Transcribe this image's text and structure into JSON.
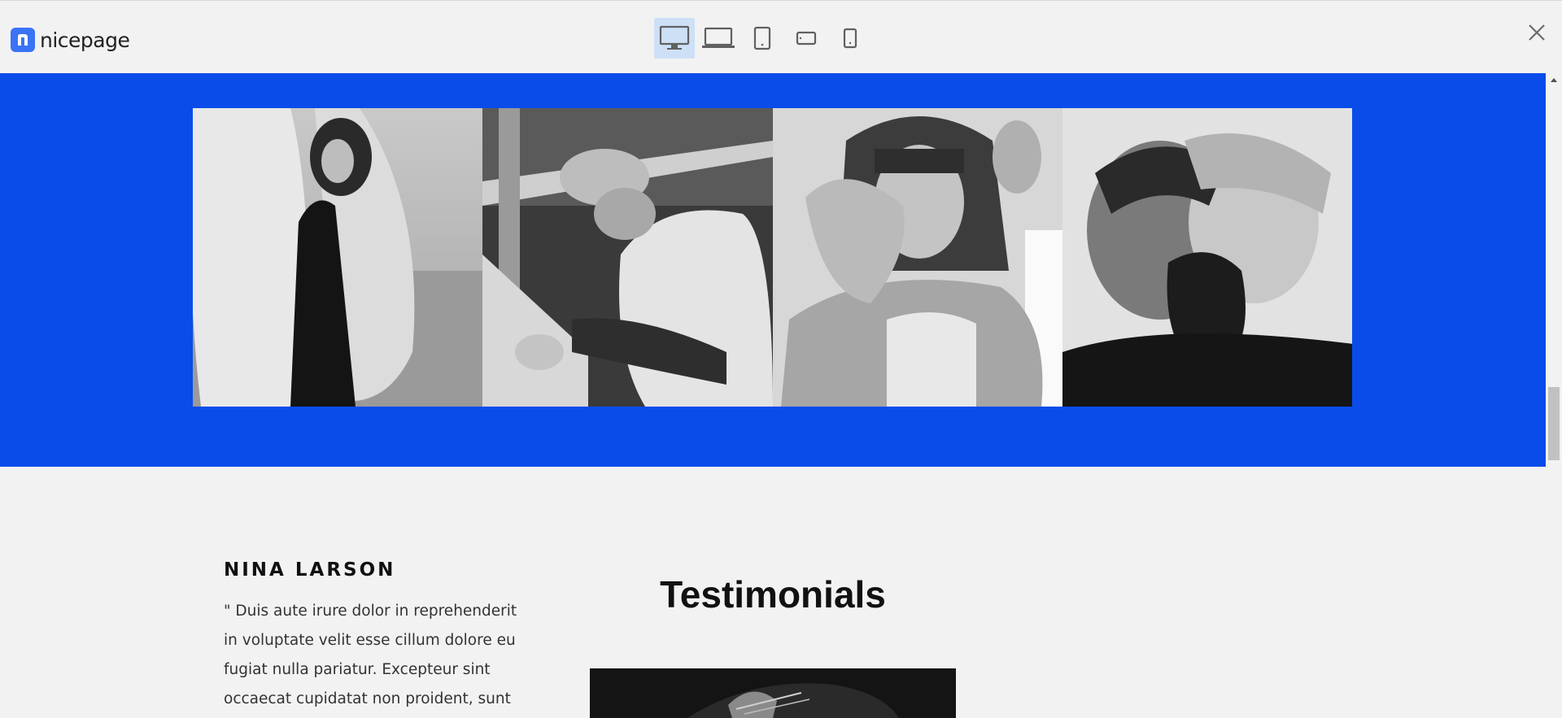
{
  "app": {
    "logo_text": "nicepage"
  },
  "toolbar": {
    "devices": [
      {
        "name": "desktop",
        "active": true
      },
      {
        "name": "laptop",
        "active": false
      },
      {
        "name": "tablet",
        "active": false
      },
      {
        "name": "phone-landscape",
        "active": false
      },
      {
        "name": "phone-portrait",
        "active": false
      }
    ],
    "active_color": "#cde0f6"
  },
  "gallery": {
    "background_color": "#0a4cea",
    "photos": [
      {
        "subject": "woman with curly hair wrapped in white fabric on a beach"
      },
      {
        "subject": "man in beanie and fleece jacket leaning on railing"
      },
      {
        "subject": "woman with bangs raising hand toward camera"
      },
      {
        "subject": "double exposure portrait of bearded man"
      }
    ]
  },
  "testimonial": {
    "name": "NINA LARSON",
    "quote": "\" Duis aute irure dolor in reprehenderit in voluptate velit esse cillum dolore eu fugiat nulla pariatur. Excepteur sint occaecat cupidatat non proident, sunt",
    "heading": "Testimonials"
  }
}
